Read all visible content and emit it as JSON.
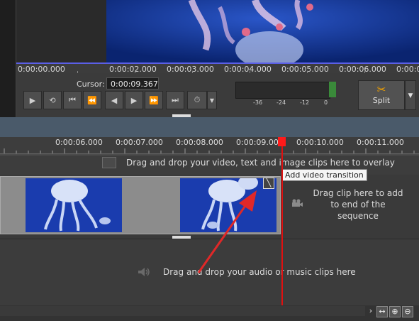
{
  "preview": {
    "ruler_labels": [
      "0:00:00.000",
      "0:00:02.000",
      "0:00:03.000",
      "0:00:04.000",
      "0:00:05.000",
      "0:00:06.000",
      "0:00:0"
    ]
  },
  "controls": {
    "cursor_label": "Cursor:",
    "cursor_value": "0:00:09.367",
    "meter_labels": [
      "-36",
      "-24",
      "-12",
      "0"
    ],
    "split_label": "Split"
  },
  "timeline": {
    "ruler_labels": [
      "0:00:06.000",
      "0:00:07.000",
      "0:00:08.000",
      "0:00:09.000",
      "0:00:10.000",
      "0:00:11.000"
    ],
    "overlay_hint": "Drag and drop your video, text and image clips here to overlay",
    "tooltip": "Add video transition",
    "drag_end_hint": "Drag clip here to add to end of the sequence",
    "audio_hint": "Drag and drop your audio or music clips here"
  },
  "colors": {
    "accent_blue": "#5b5fe6",
    "playhead": "#e01010",
    "annotation_arrow": "#e02828"
  }
}
